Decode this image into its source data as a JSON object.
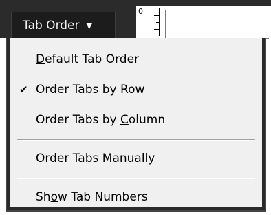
{
  "toolbar": {
    "button_label": "Tab Order",
    "button_arrow": "▼",
    "ruler_value": "0"
  },
  "menu": {
    "items": [
      {
        "pre": "",
        "accel": "D",
        "post": "efault Tab Order",
        "checked": false
      },
      {
        "pre": "Order Tabs by ",
        "accel": "R",
        "post": "ow",
        "checked": true
      },
      {
        "pre": "Order Tabs by ",
        "accel": "C",
        "post": "olumn",
        "checked": false
      },
      {
        "pre": "Order Tabs ",
        "accel": "M",
        "post": "anually",
        "checked": false
      },
      {
        "pre": "Sh",
        "accel": "o",
        "post": "w Tab Numbers",
        "checked": false
      }
    ],
    "check_glyph": "✔"
  }
}
